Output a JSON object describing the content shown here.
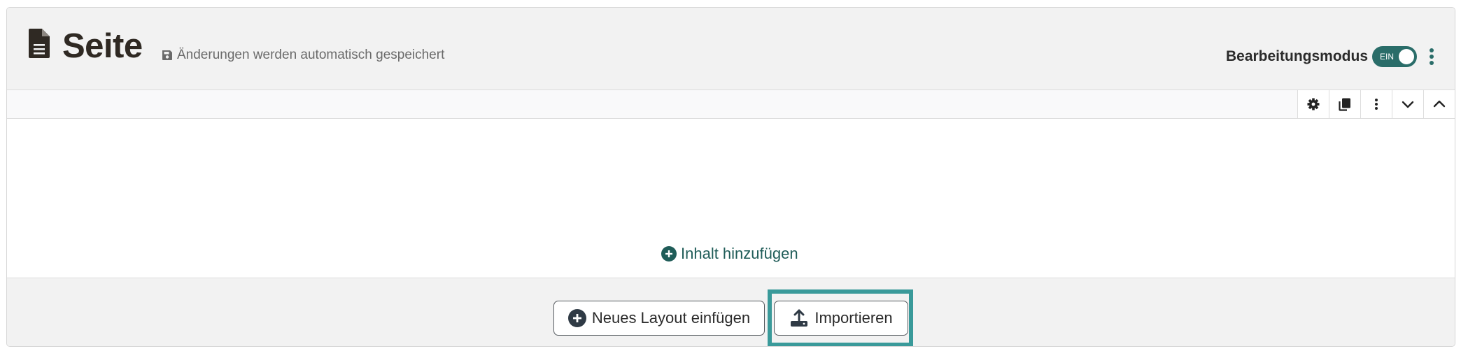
{
  "header": {
    "title": "Seite",
    "autosave_text": "Änderungen werden automatisch gespeichert",
    "edit_mode_label": "Bearbeitungsmodus",
    "toggle_state": "EIN"
  },
  "toolbar": {
    "buttons": [
      {
        "icon": "gear-icon"
      },
      {
        "icon": "copy-icon"
      },
      {
        "icon": "more-vertical-icon"
      },
      {
        "icon": "chevron-down-icon"
      },
      {
        "icon": "chevron-up-icon"
      }
    ]
  },
  "content": {
    "add_content_label": "Inhalt hinzufügen"
  },
  "footer": {
    "new_layout_label": "Neues Layout einfügen",
    "import_label": "Importieren"
  },
  "colors": {
    "accent": "#2a6d69",
    "highlight": "#3a9a9a",
    "link": "#1f5c58"
  }
}
